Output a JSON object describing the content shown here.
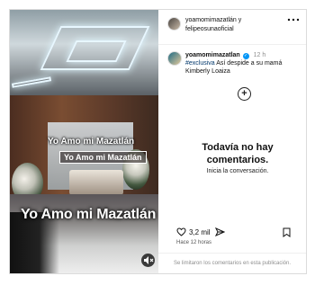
{
  "header": {
    "title": "yoamomimazatlán y felipeosunaoficial",
    "more_icon": "more-horizontal-icon"
  },
  "post": {
    "username": "yoamomimazatlan",
    "verified": true,
    "time": "12 h",
    "hashtag": "#exclusiva",
    "text": "Así despide a su mamá Kimberly Loaiza"
  },
  "media": {
    "caption_top": "Yo Amo mi Mazatlán",
    "caption_box": "Yo Amo mi Mazatlán",
    "caption_bottom": "Yo Amo mi Mazatlán",
    "mute_icon": "mute-icon"
  },
  "comments": {
    "empty_title": "Todavía no hay comentarios.",
    "empty_subtitle": "Inicia la conversación.",
    "add_icon": "plus-circle-icon"
  },
  "actions": {
    "likes": "3,2 mil",
    "time_ago": "Hace 12 horas",
    "like_icon": "heart-icon",
    "share_icon": "send-icon",
    "save_icon": "bookmark-icon"
  },
  "footer": {
    "text": "Se limitaron los comentarios en esta publicación."
  },
  "colors": {
    "verified": "#0095f6",
    "hashtag": "#00376b",
    "muted": "#8e8e8e",
    "border": "#dbdbdb"
  }
}
